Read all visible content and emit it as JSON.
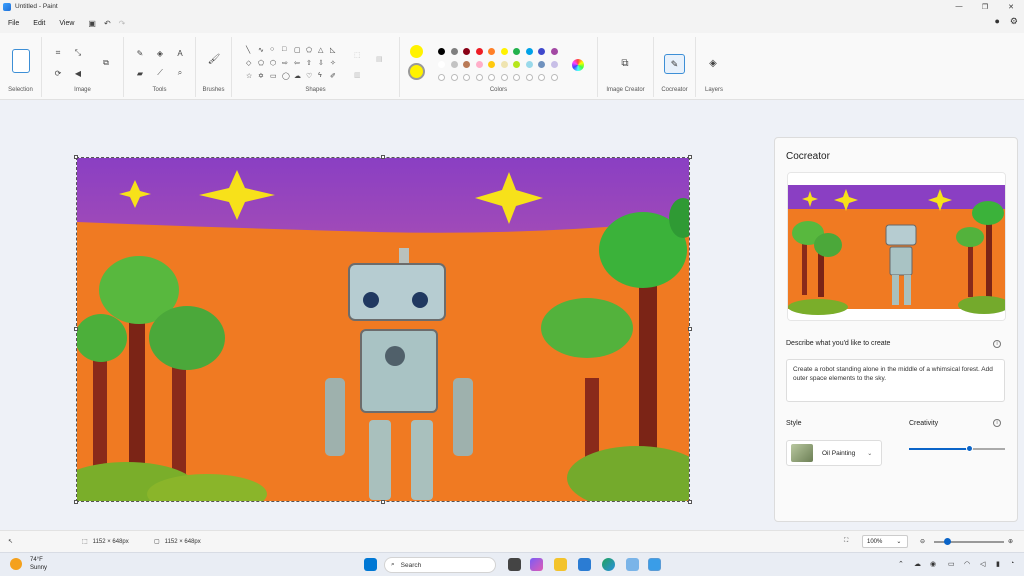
{
  "window": {
    "title": "Untitled - Paint",
    "controls": [
      "—",
      "❐",
      "✕"
    ]
  },
  "menubar": {
    "items": [
      "File",
      "Edit",
      "View"
    ],
    "quick_actions": [
      "save-icon",
      "undo-icon",
      "redo-icon"
    ]
  },
  "ribbon": {
    "groups": {
      "selection": "Selection",
      "image": "Image",
      "tools": "Tools",
      "brushes": "Brushes",
      "shapes": "Shapes",
      "colors": "Colors",
      "image_creator": "Image Creator",
      "cocreator": "Cocreator",
      "layers": "Layers"
    },
    "palette_row1": [
      "#000000",
      "#7f7f7f",
      "#880015",
      "#ed1c24",
      "#ff7f27",
      "#fff200",
      "#22b14c",
      "#00a2e8",
      "#3f48cc",
      "#a349a4"
    ],
    "palette_row2": [
      "#ffffff",
      "#c3c3c3",
      "#b97a57",
      "#ffaec9",
      "#ffc90e",
      "#efe4b0",
      "#b5e61d",
      "#99d9ea",
      "#7092be",
      "#c8bfe7"
    ],
    "primary_color": "#fff200",
    "secondary_color": "#fff200"
  },
  "statusbar": {
    "selection_size": "1152 × 648px",
    "canvas_size": "1152 × 648px",
    "zoom": "100%"
  },
  "cocreator": {
    "title": "Cocreator",
    "describe_label": "Describe what you'd like to create",
    "prompt": "Create a robot standing alone in the middle of a whimsical forest. Add outer space elements to the sky.",
    "style_label": "Style",
    "style_value": "Oil Painting",
    "creativity_label": "Creativity",
    "creativity_level": 0.62
  },
  "taskbar": {
    "temperature": "74°F",
    "condition": "Sunny",
    "search_placeholder": "Search"
  }
}
